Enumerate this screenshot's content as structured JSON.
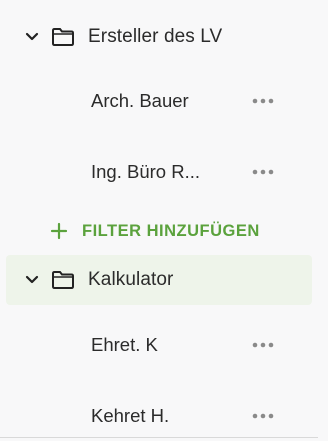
{
  "tree": {
    "groups": [
      {
        "label": "Ersteller des LV",
        "expanded": true,
        "items": [
          {
            "label": "Arch. Bauer"
          },
          {
            "label": "Ing. Büro R..."
          }
        ]
      },
      {
        "label": "Kalkulator",
        "expanded": true,
        "selected": true,
        "items": [
          {
            "label": "Ehret. K"
          },
          {
            "label": "Kehret H."
          }
        ]
      }
    ],
    "add_filter_label": "FILTER HINZUFÜGEN"
  },
  "icons": {
    "expand": "chevron-down-icon",
    "folder": "folder-icon",
    "more": "more-horizontal-icon",
    "add": "plus-icon"
  },
  "colors": {
    "accent": "#5ba23d",
    "selected_background": "#eef4ea",
    "text": "#2b2b2b",
    "muted_icon": "#8a8a8a",
    "background": "#f8f8f9"
  }
}
